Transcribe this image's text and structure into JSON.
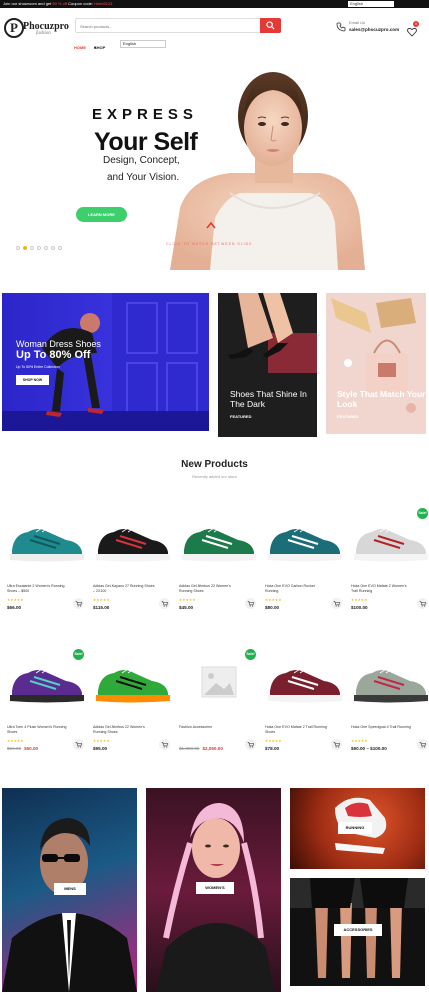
{
  "topbar": {
    "message_start": "Join our showroom and get ",
    "message_highlight": "50 % off",
    "message_mid": " Coupon code: ",
    "coupon_code": "Hotel3123",
    "language": "English"
  },
  "header": {
    "logo_initial": "P",
    "logo_name": "Phocuzpro",
    "logo_tagline": "fashion",
    "search_placeholder": "Search products...",
    "language": "English",
    "contact_label": "Email Us",
    "contact_email": "sales@phocuzpro.com",
    "cart_count": "0"
  },
  "nav": {
    "home": "HOME",
    "shop": "SHOP"
  },
  "hero": {
    "kicker": "EXPRESS",
    "headline": "Your Self",
    "line1": "Design, Concept,",
    "line2": "and Your Vision.",
    "cta": "LEARN MORE",
    "tagline": "CLICK TO MATCH BETWEEN SLIDE",
    "slide_count": 7,
    "active_slide": 1
  },
  "banners": [
    {
      "title": "Woman Dress Shoes",
      "offer": "Up To 80% Off",
      "line": "Up To 50% Entire Collection",
      "button": "SHOP NOW"
    },
    {
      "title": "Shoes That Shine In The Dark",
      "sub": "FEATURED"
    },
    {
      "title": "Style That Match Your Look",
      "sub": "FEATURED"
    }
  ],
  "new_products": {
    "title": "New Products",
    "subtitle": "Recently added our store",
    "items": [
      {
        "name": "Ultra Escalante 2 Women's Running Shoes – $500",
        "rating": "★★★★★",
        "price": "$66.00",
        "old_price": "",
        "sale": false
      },
      {
        "name": "Adidas Gel-Kayano 27 Running Shoes – 2X100",
        "rating": "★★★★★",
        "price": "$115.00",
        "old_price": "",
        "sale": false
      },
      {
        "name": "Adidas Gel-Nimbus 22 Women's Running Shoes",
        "rating": "★★★★★",
        "price": "$45.00",
        "old_price": "",
        "sale": false
      },
      {
        "name": "Hoka One EVO Carbon Rocket Running",
        "rating": "★★★★★",
        "price": "$80.00",
        "old_price": "",
        "sale": false
      },
      {
        "name": "Hoka One EVO Mafate 2 Women's Trail Running",
        "rating": "★★★★★",
        "price": "$100.00",
        "old_price": "",
        "sale": true
      },
      {
        "name": "Ultra Torin 4 Plush Women's Running Shoes",
        "rating": "★★★★★",
        "price": "$50.00",
        "old_price": "$60.00",
        "sale": true
      },
      {
        "name": "Adidas Gel-Nimbus 22 Women's Running Shoes",
        "rating": "★★★★★",
        "price": "$95.00",
        "old_price": "",
        "sale": false
      },
      {
        "name": "Fashion Accessories",
        "rating": "",
        "price": "$2,050.00",
        "old_price": "$1,850.00",
        "sale": true
      },
      {
        "name": "Hoka One EVO Mafate 2 Trail Running Shoes",
        "rating": "★★★★★",
        "price": "$78.00",
        "old_price": "",
        "sale": false
      },
      {
        "name": "Hoka One Speedgoat 4 Trail Running",
        "rating": "★★★★★",
        "price": "$90.00 – $100.00",
        "old_price": "",
        "sale": false
      }
    ]
  },
  "categories": [
    {
      "label": "MENS"
    },
    {
      "label": "WOMEN'S"
    },
    {
      "label": "RUNNING"
    },
    {
      "label": "ACCESSORIES"
    }
  ],
  "colors": {
    "accent_red": "#e53935",
    "accent_green": "#3ccf6b",
    "star_yellow": "#f2b705"
  }
}
